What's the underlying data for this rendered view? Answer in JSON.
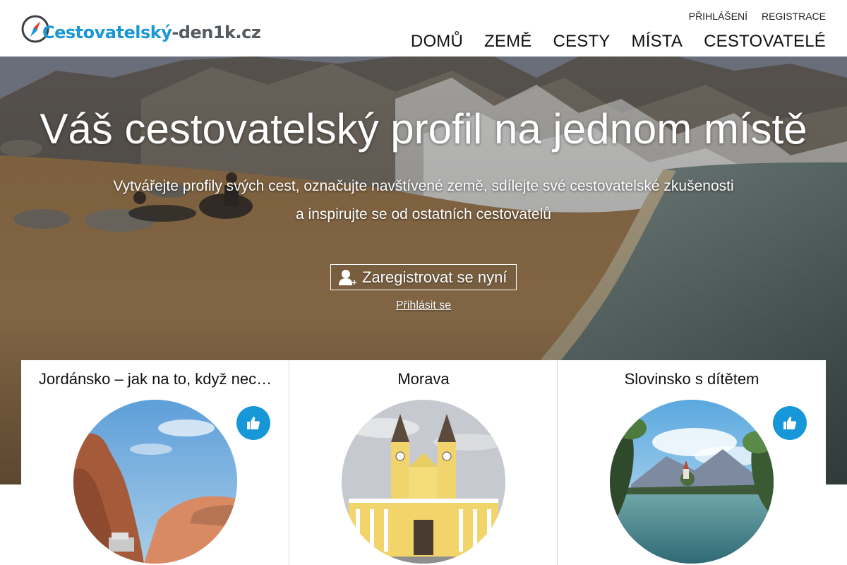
{
  "header": {
    "logo": {
      "part1": "Cestovatelský",
      "part2": "-den1k.cz"
    },
    "top_links": [
      {
        "label": "PŘIHLÁŠENÍ"
      },
      {
        "label": "REGISTRACE"
      }
    ],
    "nav": [
      {
        "label": "DOMŮ"
      },
      {
        "label": "ZEMĚ"
      },
      {
        "label": "CESTY"
      },
      {
        "label": "MÍSTA"
      },
      {
        "label": "CESTOVATELÉ"
      }
    ]
  },
  "hero": {
    "title": "Váš cestovatelský profil na jednom místě",
    "subtitle_line1": "Vytvářejte profily svých cest, označujte navštívené země, sdílejte své cestovatelské zkušenosti",
    "subtitle_line2": "a inspirujte se od ostatních cestovatelů",
    "register_label": "Zaregistrovat se nyní",
    "login_label": "Přihlásit se"
  },
  "cards": [
    {
      "title": "Jordánsko – jak na to, když nec…",
      "liked": true
    },
    {
      "title": "Morava",
      "liked": false
    },
    {
      "title": "Slovinsko s dítětem",
      "liked": true
    }
  ],
  "colors": {
    "accent": "#1597d8",
    "logo_blue": "#1a97d6",
    "logo_gray": "#555a5f"
  }
}
